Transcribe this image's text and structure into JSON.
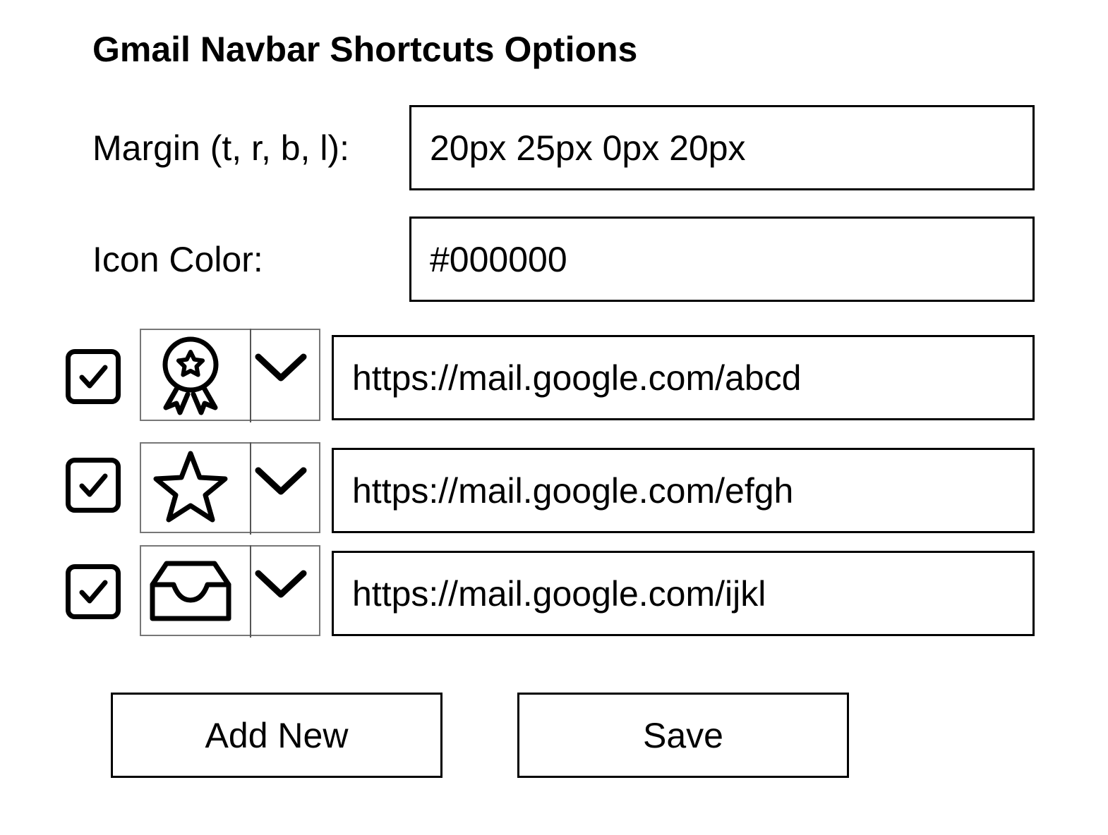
{
  "page": {
    "title": "Gmail Navbar Shortcuts Options"
  },
  "settings": {
    "margin_label": "Margin (t, r, b, l):",
    "margin_value": "20px 25px 0px 20px",
    "icon_color_label": "Icon Color:",
    "icon_color_value": "#000000"
  },
  "shortcuts": [
    {
      "enabled": true,
      "icon": "award-badge-icon",
      "url": "https://mail.google.com/abcd"
    },
    {
      "enabled": true,
      "icon": "star-icon",
      "url": "https://mail.google.com/efgh"
    },
    {
      "enabled": true,
      "icon": "inbox-tray-icon",
      "url": "https://mail.google.com/ijkl"
    }
  ],
  "actions": {
    "add_new_label": "Add New",
    "save_label": "Save"
  }
}
